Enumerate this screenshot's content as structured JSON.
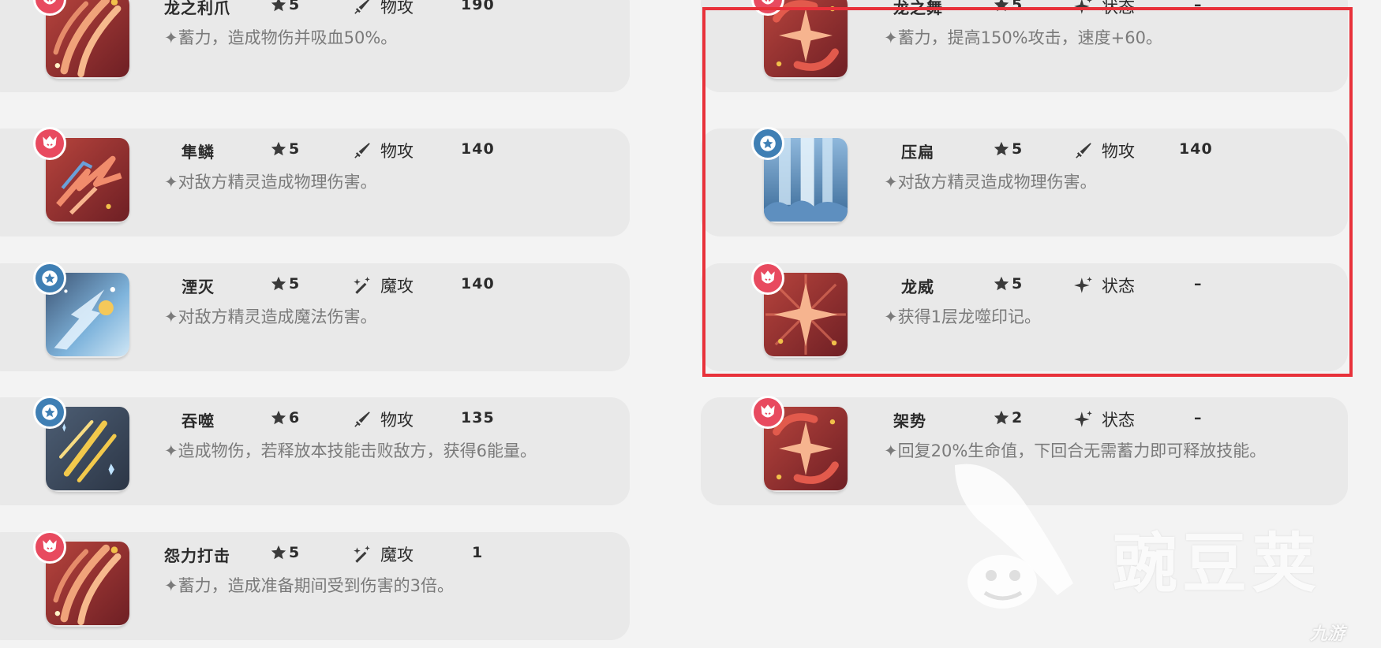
{
  "skills_left": [
    {
      "name": "龙之利爪",
      "stars": "5",
      "type": "物攻",
      "power": "190",
      "desc": "✦蓄力，造成物伤并吸血50%。",
      "element": "fire",
      "icon": "claw-slash-icon",
      "type_icon": "sword-icon"
    },
    {
      "name": "隼鳞",
      "stars": "5",
      "type": "物攻",
      "power": "140",
      "desc": "✦对敌方精灵造成物理伤害。",
      "element": "fire",
      "icon": "scale-shards-icon",
      "type_icon": "sword-icon"
    },
    {
      "name": "湮灭",
      "stars": "5",
      "type": "魔攻",
      "power": "140",
      "desc": "✦对敌方精灵造成魔法伤害。",
      "element": "water",
      "icon": "energy-burst-icon",
      "type_icon": "magic-wand-icon"
    },
    {
      "name": "吞噬",
      "stars": "6",
      "type": "物攻",
      "power": "135",
      "desc": "✦造成物伤，若释放本技能击败敌方，获得6能量。",
      "element": "water",
      "icon": "lightning-slash-icon",
      "type_icon": "sword-icon"
    },
    {
      "name": "怨力打击",
      "stars": "5",
      "type": "魔攻",
      "power": "1",
      "desc": "✦蓄力，造成准备期间受到伤害的3倍。",
      "element": "fire",
      "icon": "claw-slash-icon",
      "type_icon": "magic-wand-icon"
    }
  ],
  "skills_right": [
    {
      "name": "龙之舞",
      "stars": "5",
      "type": "状态",
      "power": "–",
      "desc": "✦蓄力，提高150%攻击，速度+60。",
      "element": "fire",
      "icon": "sparkle-swirl-icon",
      "type_icon": "sparkle-status-icon"
    },
    {
      "name": "压扁",
      "stars": "5",
      "type": "物攻",
      "power": "140",
      "desc": "✦对敌方精灵造成物理伤害。",
      "element": "water",
      "icon": "waterfall-crush-icon",
      "type_icon": "sword-icon"
    },
    {
      "name": "龙威",
      "stars": "5",
      "type": "状态",
      "power": "–",
      "desc": "✦获得1层龙噬印记。",
      "element": "fire",
      "icon": "sparkle-burst-icon",
      "type_icon": "sparkle-status-icon"
    },
    {
      "name": "架势",
      "stars": "2",
      "type": "状态",
      "power": "–",
      "desc": "✦回复20%生命值，下回合无需蓄力即可释放技能。",
      "element": "fire",
      "icon": "sparkle-swirl-icon",
      "type_icon": "sparkle-status-icon"
    }
  ],
  "watermark": {
    "brand": "豌豆荚",
    "corner": "九游"
  },
  "colors": {
    "highlight": "#e8313a",
    "fire_badge": "#e84a5f",
    "water_badge": "#3f7fb4",
    "card_bg": "#e9e9e9"
  }
}
